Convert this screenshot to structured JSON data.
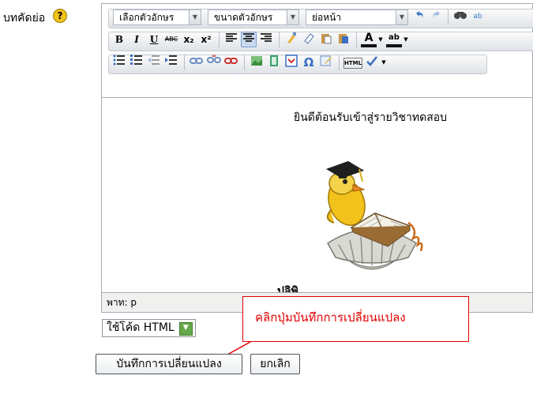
{
  "form": {
    "summary_label": "บทคัดย่อ",
    "help_icon_glyph": "?"
  },
  "toolbar": {
    "font_family_select": "เลือกตัวอักษร",
    "font_size_select": "ขนาดตัวอักษร",
    "format_select": "ย่อหน้า",
    "bold": "B",
    "italic": "I",
    "underline": "U",
    "strikethrough": "ABC",
    "subscript": "x₂",
    "superscript": "x²",
    "text_color": "A",
    "highlight": "ab",
    "special_char": "Ω",
    "html_source": "HTML"
  },
  "editor": {
    "welcome_text": "ยินดีต้อนรับเข้าสู่รายวิชาทดสอบ",
    "clipped_line": "ปลิพิ... ... ... ...",
    "statusbar_path": "พาท: p"
  },
  "below_editor": {
    "html_toggle_label": "ใช้โค้ด HTML",
    "callout_text": "คลิกปุ่มบันทึกการเปลี่ยนแปลง",
    "save_button": "บันทึกการเปลี่ยนแปลง",
    "cancel_button": "ยกเลิก"
  },
  "colors": {
    "callout_red": "#e30000",
    "toggle_green": "#66a94b"
  }
}
